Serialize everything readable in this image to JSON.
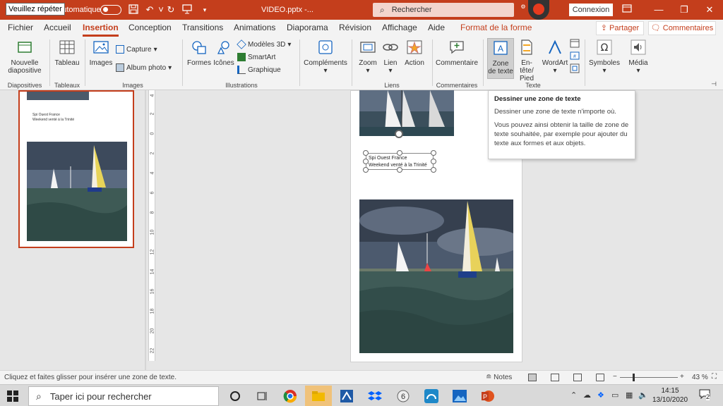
{
  "titlebar": {
    "tooltip_repeat": "Veuillez répéter",
    "autosave_text": "t automatique",
    "filename": "VIDEO.pptx  -...",
    "search_placeholder": "Rechercher",
    "connexion_label": "Connexion",
    "minimize": "—",
    "restore": "❐",
    "close": "✕"
  },
  "menu": {
    "tabs": [
      "Fichier",
      "Accueil",
      "Insertion",
      "Conception",
      "Transitions",
      "Animations",
      "Diaporama",
      "Révision",
      "Affichage",
      "Aide",
      "Format de la forme"
    ],
    "active_tab": "Insertion",
    "share_label": "Partager",
    "comments_label": "Commentaires"
  },
  "ribbon": {
    "new_slide": "Nouvelle\ndiapositive",
    "table": "Tableau",
    "images": "Images",
    "capture": "Capture",
    "album": "Album photo",
    "shapes": "Formes",
    "icons": "Icônes",
    "models3d": "Modèles 3D",
    "smartart": "SmartArt",
    "chart": "Graphique",
    "addins": "Compléments",
    "zoom": "Zoom",
    "link": "Lien",
    "action": "Action",
    "comment": "Commentaire",
    "textbox": "Zone\nde texte",
    "header_footer": "En-tête/\nPied",
    "wordart": "WordArt",
    "symbols": "Symboles",
    "media": "Média",
    "groups": {
      "slides": "Diapositives",
      "tables": "Tableaux",
      "images": "Images",
      "illustrations": "Illustrations",
      "links": "Liens",
      "comments": "Commentaires",
      "text": "Texte"
    }
  },
  "tooltip": {
    "title": "Dessiner une zone de texte",
    "p1": "Dessiner une zone de texte n'importe où.",
    "p2": "Vous pouvez ainsi obtenir la taille de zone de texte souhaitée, par exemple pour ajouter du texte aux formes et aux objets."
  },
  "thumbnail": {
    "line1": "Spi Ouest France",
    "line2": "Weekend venté à la Trinité"
  },
  "slide": {
    "caption_line1": "Spi Ouest France",
    "caption_line2": "Weekend venté à la Trinité"
  },
  "ruler": {
    "numbers": [
      "4",
      "2",
      "0",
      "2",
      "4",
      "6",
      "8",
      "10",
      "12",
      "14",
      "16",
      "18",
      "20",
      "22"
    ]
  },
  "statusbar": {
    "text": "Cliquez et faites glisser pour insérer une zone de texte.",
    "notes": "Notes",
    "zoom": "43 %",
    "minus": "−",
    "plus": "+"
  },
  "taskbar": {
    "search_placeholder": "Taper ici pour rechercher",
    "time": "14:15",
    "date": "13/10/2020",
    "notification_count": "2"
  },
  "colors": {
    "accent": "#c43e1c",
    "ribbon_bg": "#f3f3f3",
    "workspace_bg": "#e6e6e6"
  }
}
